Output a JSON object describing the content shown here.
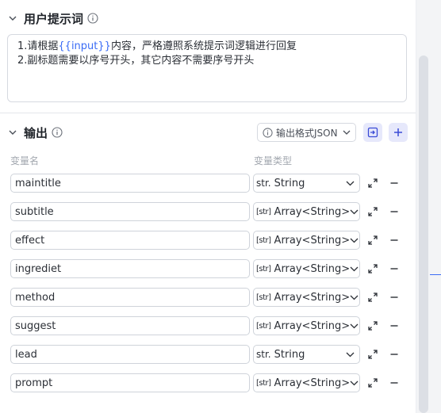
{
  "prompt_section": {
    "title": "用户提示词",
    "lines": [
      {
        "before": "1.请根据",
        "var": "{{input}}",
        "after": "内容，严格遵照系统提示词逻辑进行回复"
      },
      {
        "before": "2.副标题需要以序号开头，其它内容不需要序号开头",
        "var": "",
        "after": ""
      }
    ]
  },
  "output_section": {
    "title": "输出",
    "format_label": "输出格式JSON",
    "col_name": "变量名",
    "col_type": "变量类型",
    "rows": [
      {
        "name": "maintitle",
        "type_icon": "str.",
        "type": "String"
      },
      {
        "name": "subtitle",
        "type_icon": "[str]",
        "type": "Array<String>"
      },
      {
        "name": "effect",
        "type_icon": "[str]",
        "type": "Array<String>"
      },
      {
        "name": "ingrediet",
        "type_icon": "[str]",
        "type": "Array<String>"
      },
      {
        "name": "method",
        "type_icon": "[str]",
        "type": "Array<String>"
      },
      {
        "name": "suggest",
        "type_icon": "[str]",
        "type": "Array<String>"
      },
      {
        "name": "lead",
        "type_icon": "str.",
        "type": "String"
      },
      {
        "name": "prompt",
        "type_icon": "[str]",
        "type": "Array<String>"
      }
    ]
  },
  "colors": {
    "accent": "#3a6cf5",
    "button_bg": "#e6e8fb",
    "border": "#cfd3da"
  }
}
